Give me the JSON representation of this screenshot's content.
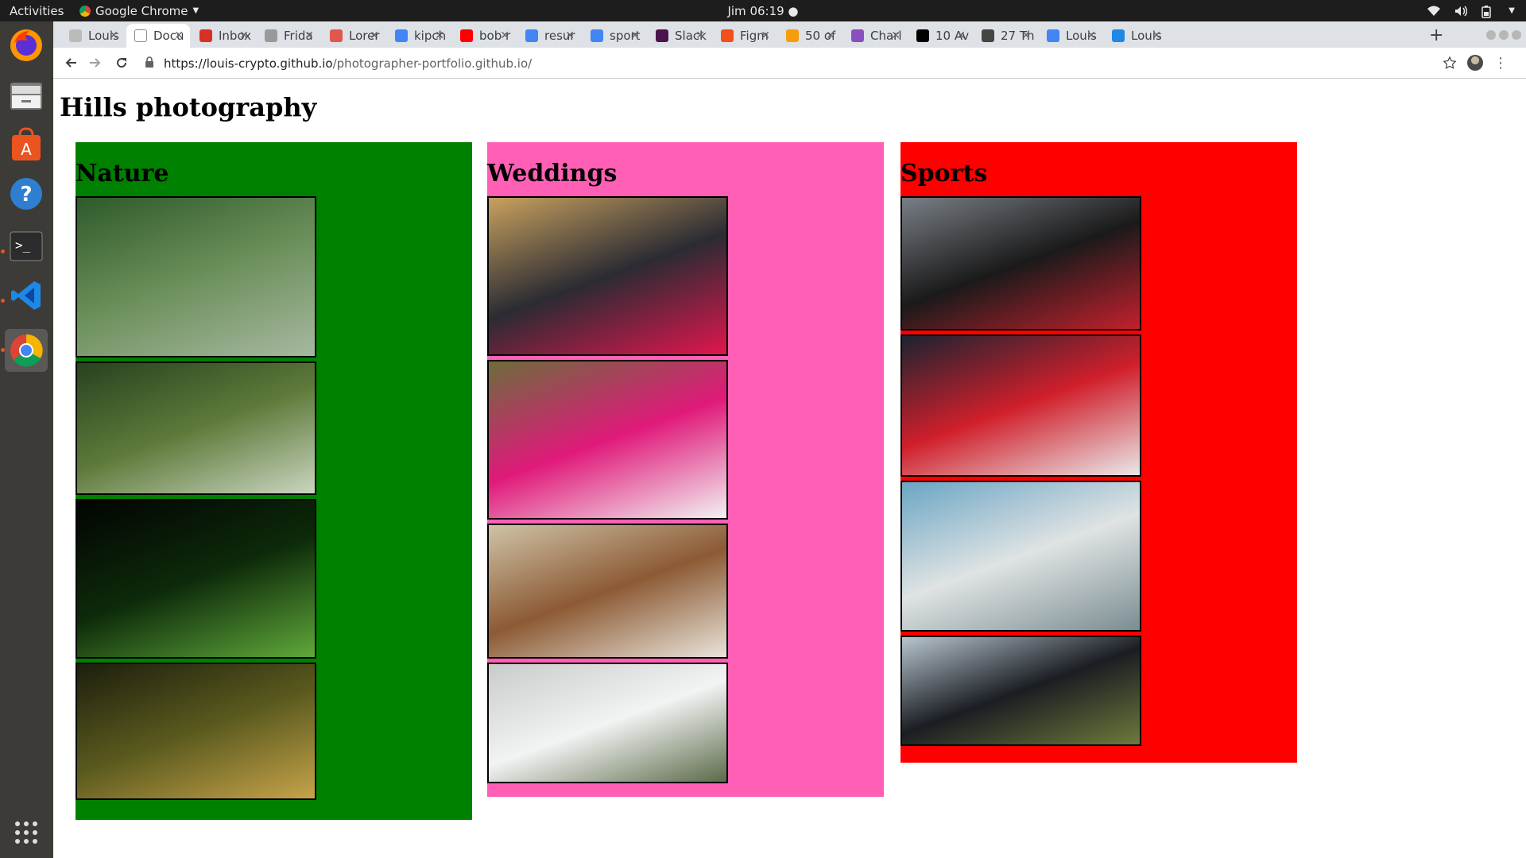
{
  "system": {
    "activities": "Activities",
    "app_name": "Google Chrome",
    "clock": "Jim 06:19 ●"
  },
  "browser": {
    "tabs": [
      {
        "title": "Louis",
        "fav": "#bbb",
        "active": false
      },
      {
        "title": "Docu",
        "fav": "#fff",
        "active": true
      },
      {
        "title": "Inbox",
        "fav": "#d93025",
        "active": false
      },
      {
        "title": "Frida",
        "fav": "#999",
        "active": false
      },
      {
        "title": "Lorer",
        "fav": "#e2574c",
        "active": false
      },
      {
        "title": "kipch",
        "fav": "#4285f4",
        "active": false
      },
      {
        "title": "bob r",
        "fav": "#ff0000",
        "active": false
      },
      {
        "title": "resur",
        "fav": "#4285f4",
        "active": false
      },
      {
        "title": "sport",
        "fav": "#4285f4",
        "active": false
      },
      {
        "title": "Slack",
        "fav": "#4a154b",
        "active": false
      },
      {
        "title": "Figm",
        "fav": "#f24e1e",
        "active": false
      },
      {
        "title": "50 of",
        "fav": "#f59e0b",
        "active": false
      },
      {
        "title": "Charl",
        "fav": "#8a4fbf",
        "active": false
      },
      {
        "title": "10 Av",
        "fav": "#000",
        "active": false
      },
      {
        "title": "27 Th",
        "fav": "#444",
        "active": false
      },
      {
        "title": "Louis",
        "fav": "#4285f4",
        "active": false
      },
      {
        "title": "Louis",
        "fav": "#1e88e5",
        "active": false
      }
    ],
    "url_host": "https://louis-crypto.github.io",
    "url_path": "/photographer-portfolio.github.io/"
  },
  "page": {
    "title": "Hills photography",
    "sections": [
      {
        "heading": "Nature",
        "color": "#008000",
        "photos": [
          {
            "alt": "forest stream",
            "colors": [
              "#2e5a2a",
              "#6b8f5a",
              "#a7b8a0"
            ]
          },
          {
            "alt": "squirrel in flowers",
            "colors": [
              "#27421f",
              "#5e7a3a",
              "#c9d5bf"
            ]
          },
          {
            "alt": "leaf skeleton",
            "colors": [
              "#020402",
              "#0d2a0a",
              "#5fa83a"
            ]
          },
          {
            "alt": "deer in forest",
            "colors": [
              "#1d1e0d",
              "#5a5a1e",
              "#c7a34a"
            ]
          }
        ]
      },
      {
        "heading": "Weddings",
        "color": "#ff5fb4",
        "photos": [
          {
            "alt": "wedding party portrait",
            "colors": [
              "#c8a15e",
              "#2b2b33",
              "#e0164e"
            ]
          },
          {
            "alt": "bridesmaids in pink",
            "colors": [
              "#6b6d3b",
              "#e0197a",
              "#f2f2f2"
            ]
          },
          {
            "alt": "traditional dancers",
            "colors": [
              "#cfc3a8",
              "#8c5a34",
              "#e9e4da"
            ]
          },
          {
            "alt": "wedding tents",
            "colors": [
              "#c8ccc9",
              "#f2f3f3",
              "#5c6b4a"
            ]
          }
        ]
      },
      {
        "heading": "Sports",
        "color": "#ff0000",
        "photos": [
          {
            "alt": "athlete with Kenya flag",
            "colors": [
              "#7a7f86",
              "#1a1a1a",
              "#c3202d"
            ]
          },
          {
            "alt": "football team in red",
            "colors": [
              "#1b2330",
              "#d01f2b",
              "#e9e9e9"
            ]
          },
          {
            "alt": "stadium swimming pool",
            "colors": [
              "#6ba5c4",
              "#dfe3e3",
              "#7b8d92"
            ]
          },
          {
            "alt": "rugby training",
            "colors": [
              "#b8c5cf",
              "#1a1d22",
              "#6d7a3b"
            ]
          }
        ]
      }
    ]
  }
}
